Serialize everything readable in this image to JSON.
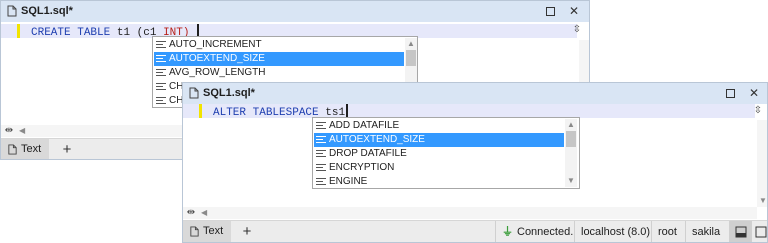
{
  "window1": {
    "title": "SQL1.sql*",
    "code": {
      "kw1": "CREATE",
      "kw2": "TABLE",
      "ident": "t1",
      "paren": "(c1",
      "type": "INT)"
    },
    "autocomplete": [
      "AUTO_INCREMENT",
      "AUTOEXTEND_SIZE",
      "AVG_ROW_LENGTH",
      "CHA",
      "CHA"
    ],
    "selected_index": 1,
    "tab_label": "Text"
  },
  "window2": {
    "title": "SQL1.sql*",
    "code": {
      "kw1": "ALTER",
      "kw2": "TABLESPACE",
      "ident": "ts1"
    },
    "autocomplete": [
      "ADD DATAFILE",
      "AUTOEXTEND_SIZE",
      "DROP DATAFILE",
      "ENCRYPTION",
      "ENGINE"
    ],
    "selected_index": 1,
    "tab_label": "Text",
    "status": {
      "connection": "Connected.",
      "server": "localhost (8.0)",
      "user": "root",
      "schema": "sakila"
    }
  },
  "icons": {
    "file": "file-icon",
    "close": "close-icon",
    "maximize": "maximize-icon",
    "split_vertical": "split-vertical-icon",
    "split_horizontal": "split-horizontal-icon",
    "add": "plus-icon",
    "plug": "plug-icon",
    "panel_bottom": "panel-bottom-icon",
    "panel_square": "panel-square-icon",
    "completion_item": "keyword-lines-icon"
  },
  "colors": {
    "titlebar": "#d9e5f4",
    "keyword": "#1f3fb0",
    "type_keyword": "#b8221b",
    "selection": "#3399ff",
    "current_line": "#e6e8fa",
    "connected": "#3a9d3a"
  }
}
